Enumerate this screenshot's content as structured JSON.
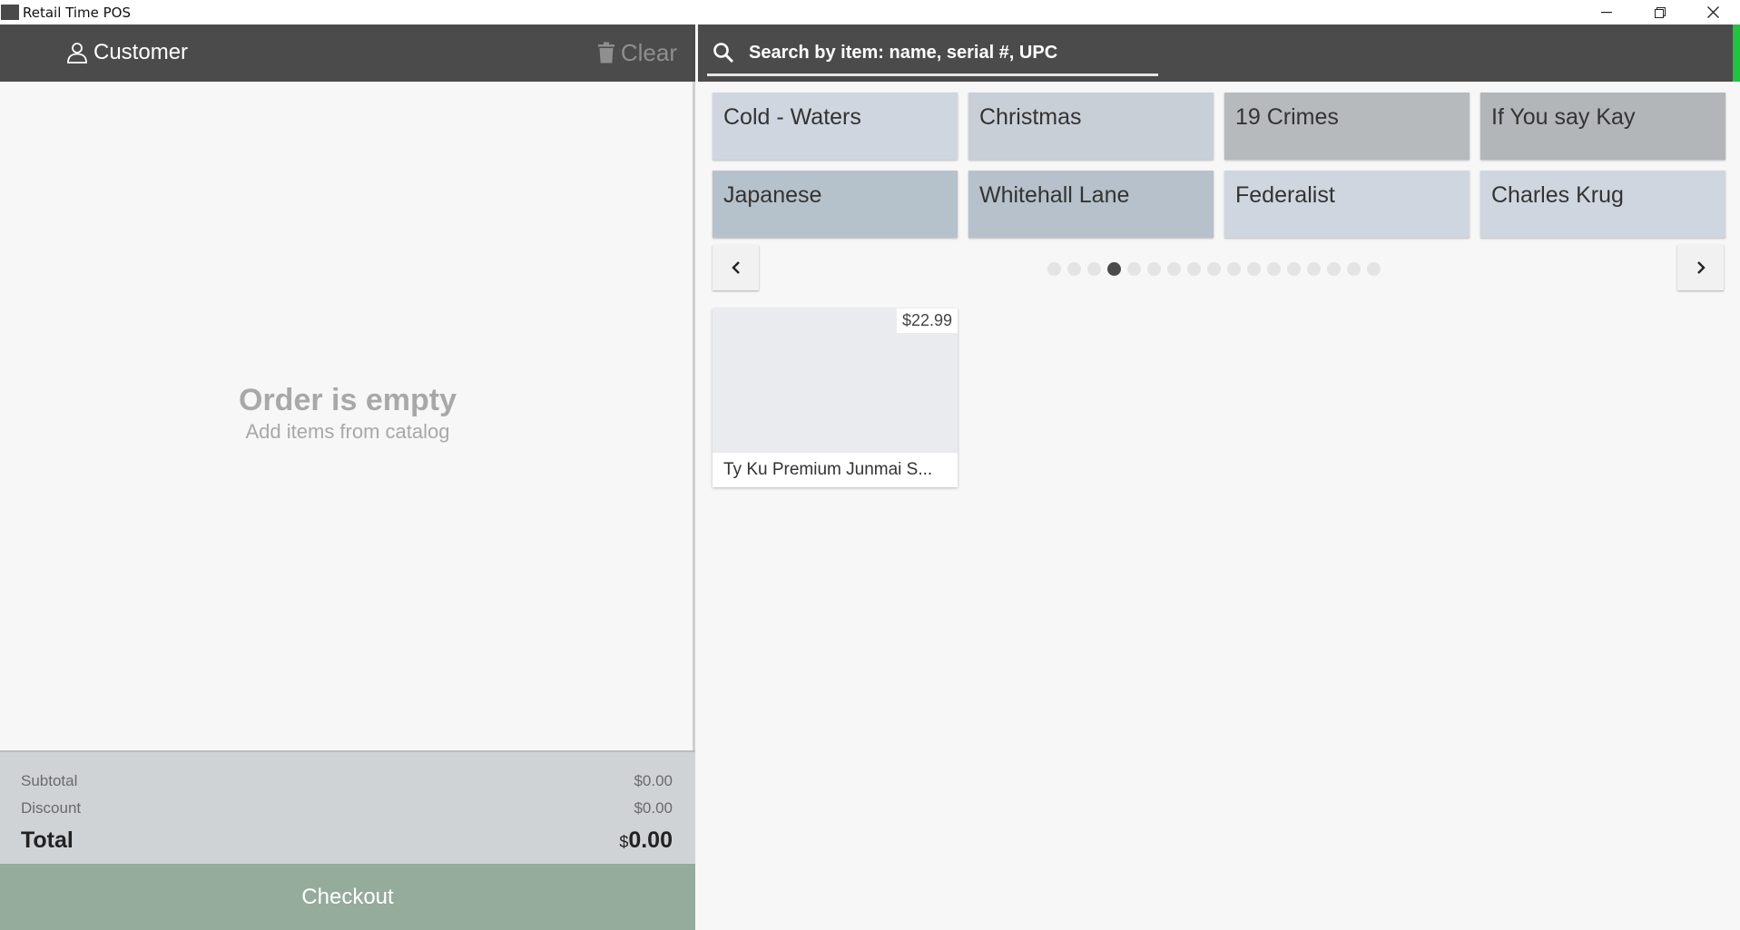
{
  "window": {
    "title": "Retail Time POS",
    "controls": [
      "minimize",
      "restore",
      "close"
    ]
  },
  "order": {
    "customer_label": "Customer",
    "clear_label": "Clear",
    "empty_title": "Order is empty",
    "empty_subtitle": "Add items from catalog",
    "subtotal_label": "Subtotal",
    "subtotal_value": "$0.00",
    "discount_label": "Discount",
    "discount_value": "$0.00",
    "total_label": "Total",
    "total_currency": "$",
    "total_amount": "0.00",
    "checkout_label": "Checkout"
  },
  "search": {
    "placeholder": "Search by item: name, serial #, UPC"
  },
  "categories": [
    {
      "label": "Cold - Waters",
      "color": "#d0d6df"
    },
    {
      "label": "Christmas",
      "color": "#c9cfd6"
    },
    {
      "label": "19 Crimes",
      "color": "#b6babd"
    },
    {
      "label": "If You say Kay",
      "color": "#b2b6b8"
    },
    {
      "label": "Japanese",
      "color": "#b6c2cb"
    },
    {
      "label": "Whitehall Lane",
      "color": "#b6c1cb"
    },
    {
      "label": "Federalist",
      "color": "#d0d6df"
    },
    {
      "label": "Charles Krug",
      "color": "#d0d6df"
    }
  ],
  "pagination": {
    "total_pages": 17,
    "current_page": 4
  },
  "products": [
    {
      "name": "Ty Ku Premium Junmai S...",
      "price": "$22.99"
    }
  ],
  "colors": {
    "header": "#4b4b4b",
    "accent_green": "#21c340",
    "checkout": "#95ab9c"
  }
}
